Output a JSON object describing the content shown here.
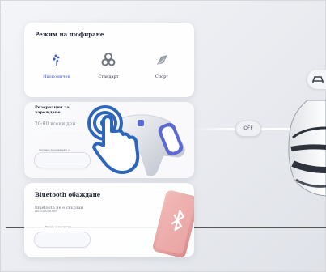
{
  "drive_mode": {
    "title": "Режим на шофиране",
    "modes": [
      {
        "label": "Икономичен",
        "icon": "leaf-icon",
        "active": true
      },
      {
        "label": "Стандарт",
        "icon": "steering-icon",
        "active": false
      },
      {
        "label": "Спорт",
        "icon": "speed-icon",
        "active": false
      }
    ]
  },
  "charging": {
    "title": "Резервация за зареждане",
    "time": "20:00 всеки ден",
    "note": "Започнете да резервирате се"
  },
  "bluetooth": {
    "title": "Bluetooth обаждане",
    "status": "Bluetooth не е свързан",
    "device_id": "400-92-333-868,1867",
    "label": "Върнете се към списъка"
  },
  "off_button": {
    "label": "OFF"
  },
  "colors": {
    "accent": "#4458b8",
    "hand": "#2d66b8",
    "phone": "#e9a6a6"
  }
}
